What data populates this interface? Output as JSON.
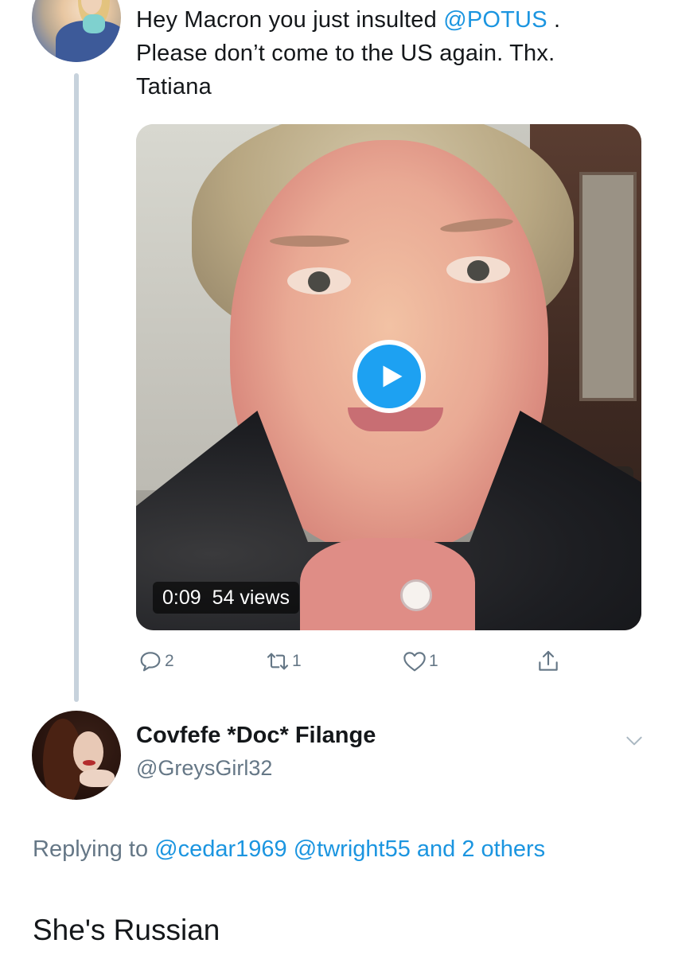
{
  "tweet1": {
    "text_line1": "Hey Macron you just insulted ",
    "mention": "@POTUS",
    "text_line1_end": " .",
    "text_line2": "Please don’t come to the US again. Thx.",
    "text_line3": "Tatiana",
    "video": {
      "duration": "0:09",
      "views": "54 views"
    },
    "actions": {
      "reply_count": "2",
      "retweet_count": "1",
      "like_count": "1"
    }
  },
  "tweet2": {
    "name": "Covfefe *Doc* Filange",
    "handle": "@GreysGirl32",
    "replying_prefix": "Replying to ",
    "replying_mention1": "@cedar1969",
    "replying_mention2": "@twright55",
    "replying_others": "and 2 others",
    "body": "She's Russian"
  },
  "icons": {
    "play": "play-icon",
    "reply": "reply-icon",
    "retweet": "retweet-icon",
    "like": "heart-icon",
    "share": "share-icon",
    "chevron": "chevron-down-icon"
  },
  "colors": {
    "link": "#1b95e0",
    "play_button": "#1da1f2",
    "secondary_text": "#657786",
    "primary_text": "#14171a"
  }
}
